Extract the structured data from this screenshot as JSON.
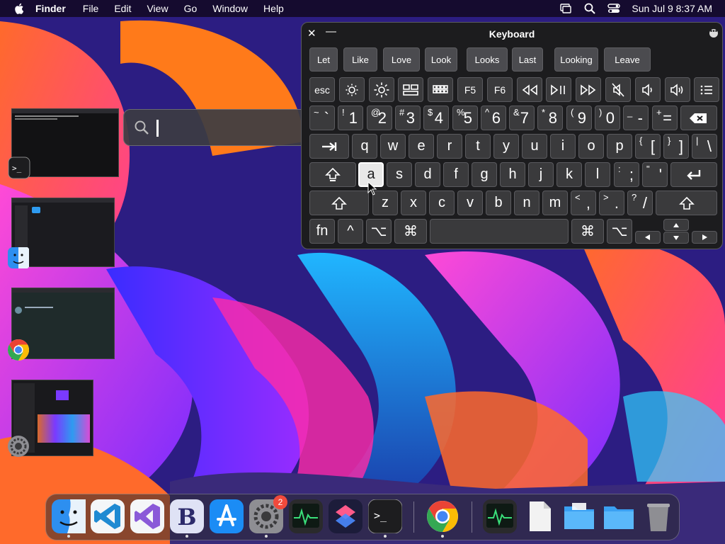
{
  "menubar": {
    "app": "Finder",
    "items": [
      "File",
      "Edit",
      "View",
      "Go",
      "Window",
      "Help"
    ],
    "clock": "Sun Jul 9  8:37 AM"
  },
  "search": {
    "placeholder": "",
    "value": ""
  },
  "keyboard": {
    "title": "Keyboard",
    "suggestions": [
      "Let",
      "Like",
      "Love",
      "Look",
      "Looks",
      "Last",
      "Looking",
      "Leave"
    ],
    "fn_row": [
      "esc",
      "brightness-down-icon",
      "brightness-up-icon",
      "mission-control-icon",
      "launchpad-icon",
      "F5",
      "F6",
      "rewind-icon",
      "play-pause-icon",
      "fast-forward-icon",
      "mute-icon",
      "volume-down-icon",
      "volume-up-icon",
      "list-icon"
    ],
    "number_row": [
      {
        "shift": "~",
        "main": "`"
      },
      {
        "shift": "!",
        "main": "1"
      },
      {
        "shift": "@",
        "main": "2"
      },
      {
        "shift": "#",
        "main": "3"
      },
      {
        "shift": "$",
        "main": "4"
      },
      {
        "shift": "%",
        "main": "5"
      },
      {
        "shift": "^",
        "main": "6"
      },
      {
        "shift": "&",
        "main": "7"
      },
      {
        "shift": "*",
        "main": "8"
      },
      {
        "shift": "(",
        "main": "9"
      },
      {
        "shift": ")",
        "main": "0"
      },
      {
        "shift": "_",
        "main": "-"
      },
      {
        "shift": "+",
        "main": "="
      }
    ],
    "row_q": [
      "q",
      "w",
      "e",
      "r",
      "t",
      "y",
      "u",
      "i",
      "o",
      "p"
    ],
    "row_q_extra": [
      {
        "shift": "{",
        "main": "["
      },
      {
        "shift": "}",
        "main": "]"
      },
      {
        "shift": "|",
        "main": "\\"
      }
    ],
    "row_a": [
      "a",
      "s",
      "d",
      "f",
      "g",
      "h",
      "j",
      "k",
      "l"
    ],
    "row_a_extra": [
      {
        "shift": ":",
        "main": ";"
      },
      {
        "shift": "\"",
        "main": "'"
      }
    ],
    "row_z": [
      "z",
      "x",
      "c",
      "v",
      "b",
      "n",
      "m"
    ],
    "row_z_extra": [
      {
        "shift": "<",
        "main": ","
      },
      {
        "shift": ">",
        "main": "."
      },
      {
        "shift": "?",
        "main": "/"
      }
    ],
    "bottom": {
      "fn": "fn",
      "ctrl": "^",
      "opt": "⌥",
      "cmd": "⌘"
    },
    "selected_key": "a"
  },
  "dock": {
    "items": [
      "Finder",
      "Visual Studio Code",
      "Visual Studio",
      "BBEdit",
      "App Store",
      "System Settings",
      "Activity Monitor",
      "Shortcuts",
      "Terminal",
      "Google Chrome",
      "Activity Monitor",
      "Document",
      "Folder",
      "Folder",
      "Trash"
    ],
    "settings_badge": "2"
  },
  "colors": {
    "accent": "#0a84ff",
    "badge": "#f14a3c",
    "keyboard_bg": "#1c1c1e",
    "key_bg": "#3a3a3c"
  }
}
